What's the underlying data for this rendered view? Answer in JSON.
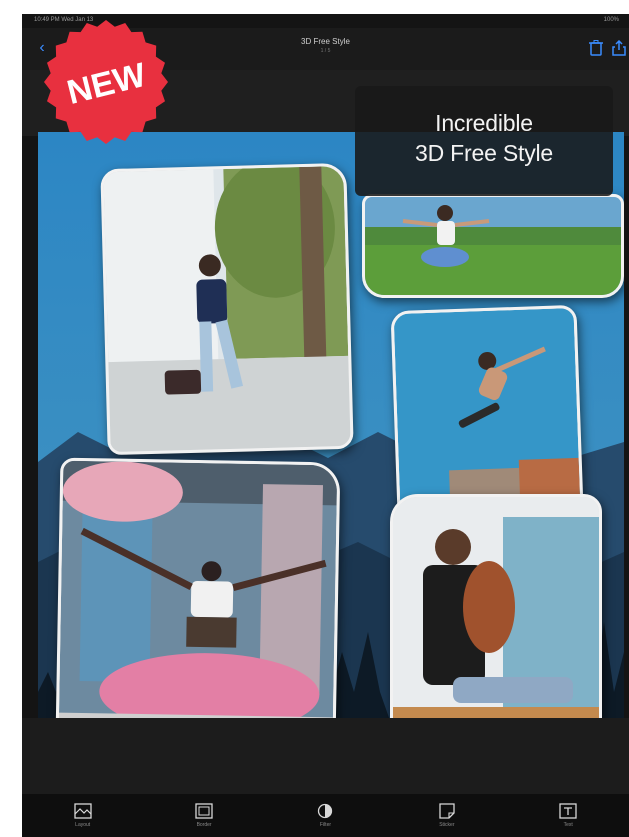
{
  "status_bar": {
    "left": "10:49 PM  Wed Jan 13",
    "right": "100%"
  },
  "nav": {
    "title": "3D Free Style",
    "subtitle": "1 / 5",
    "back": "‹"
  },
  "badge": {
    "text": "NEW",
    "color": "#e8303f"
  },
  "promo": {
    "line1": "Incredible",
    "line2": "3D Free Style"
  },
  "toolbar": [
    {
      "label": "Layout",
      "icon": "layout-icon"
    },
    {
      "label": "Border",
      "icon": "frame-icon"
    },
    {
      "label": "Filter",
      "icon": "contrast-icon"
    },
    {
      "label": "Sticker",
      "icon": "sticker-icon"
    },
    {
      "label": "Text",
      "icon": "text-box-icon"
    }
  ],
  "colors": {
    "accent": "#3a8cff",
    "sky": "#2b7fb8",
    "mountain": "#1e3a5a"
  }
}
